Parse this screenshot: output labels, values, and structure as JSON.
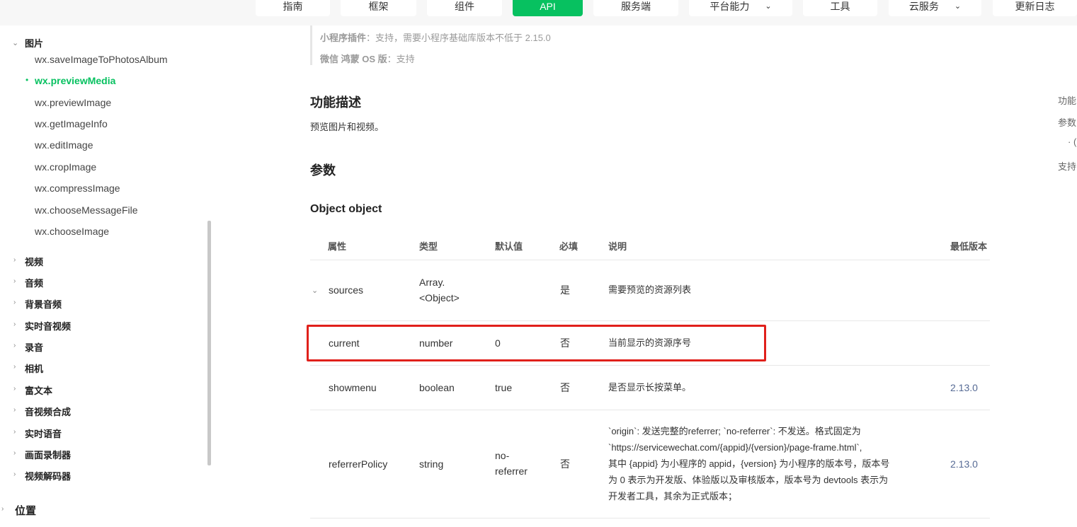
{
  "topnav": {
    "items": [
      {
        "label": "指南",
        "active": false
      },
      {
        "label": "框架",
        "active": false
      },
      {
        "label": "组件",
        "active": false
      },
      {
        "label": "API",
        "active": true
      },
      {
        "label": "服务端",
        "active": false
      },
      {
        "label": "平台能力",
        "active": false,
        "has_dropdown": true
      },
      {
        "label": "工具",
        "active": false
      },
      {
        "label": "云服务",
        "active": false,
        "has_dropdown": true
      },
      {
        "label": "更新日志",
        "active": false
      }
    ]
  },
  "sidebar": {
    "group_open": {
      "label": "图片",
      "caret": "chevron-down"
    },
    "items": [
      {
        "label": "wx.saveImageToPhotosAlbum",
        "active": false
      },
      {
        "label": "wx.previewMedia",
        "active": true
      },
      {
        "label": "wx.previewImage",
        "active": false
      },
      {
        "label": "wx.getImageInfo",
        "active": false
      },
      {
        "label": "wx.editImage",
        "active": false
      },
      {
        "label": "wx.cropImage",
        "active": false
      },
      {
        "label": "wx.compressImage",
        "active": false
      },
      {
        "label": "wx.chooseMessageFile",
        "active": false
      },
      {
        "label": "wx.chooseImage",
        "active": false
      }
    ],
    "groups_collapsed": [
      "视频",
      "音频",
      "背景音频",
      "实时音视频",
      "录音",
      "相机",
      "富文本",
      "音视频合成",
      "实时语音",
      "画面录制器",
      "视频解码器"
    ],
    "section": "位置"
  },
  "main": {
    "support_lines": [
      {
        "label": "小程序插件",
        "text": "：支持，需要小程序基础库版本不低于 2.15.0"
      },
      {
        "label": "微信 鸿蒙 OS 版",
        "text": "：支持"
      }
    ],
    "desc_title": "功能描述",
    "desc_text": "预览图片和视频。",
    "params_title": "参数",
    "object_title": "Object object",
    "table": {
      "headers": [
        "属性",
        "类型",
        "默认值",
        "必填",
        "说明",
        "最低版本"
      ],
      "rows": [
        {
          "name": "sources",
          "type_line1": "Array.",
          "type_line2": "<Object>",
          "default": "",
          "required": "是",
          "desc": "需要预览的资源列表",
          "version": "",
          "expandable": true
        },
        {
          "name": "current",
          "type_line1": "number",
          "type_line2": "",
          "default": "0",
          "required": "否",
          "desc": "当前显示的资源序号",
          "version": "",
          "highlighted": true
        },
        {
          "name": "showmenu",
          "type_line1": "boolean",
          "type_line2": "",
          "default": "true",
          "required": "否",
          "desc": "是否显示长按菜单。",
          "version": "2.13.0"
        },
        {
          "name": "referrerPolicy",
          "type_line1": "string",
          "type_line2": "",
          "default_line1": "no-",
          "default_line2": "referrer",
          "required": "否",
          "desc_lines": [
            "`origin`: 发送完整的referrer; `no-referrer`: 不发送。格式固定为",
            "`https://servicewechat.com/{appid}/{version}/page-frame.html`,",
            "其中 {appid} 为小程序的 appid，{version} 为小程序的版本号，版本号",
            "为 0 表示为开发版、体验版以及审核版本，版本号为 devtools 表示为",
            "开发者工具，其余为正式版本；"
          ],
          "version": "2.13.0"
        }
      ]
    }
  },
  "toc": {
    "items": [
      "功能",
      "参数",
      "· (",
      "支持"
    ]
  },
  "colors": {
    "accent": "#07c160",
    "link": "#576b95",
    "highlight_border": "#e0201b"
  }
}
